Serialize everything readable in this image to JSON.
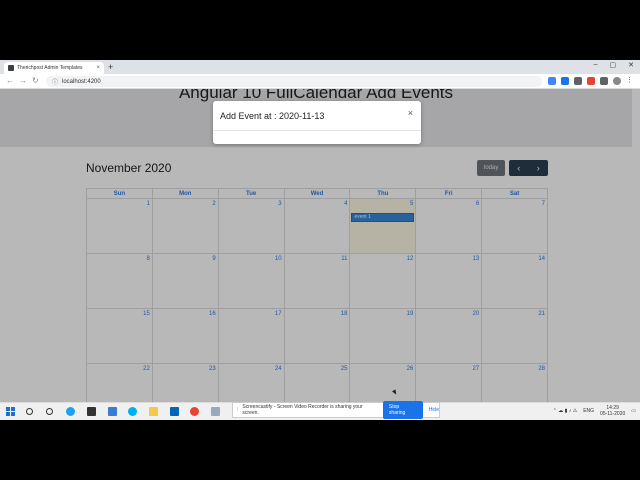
{
  "browser": {
    "tab_title": "Therichpost Admin Templates",
    "tab_close": "×",
    "new_tab": "+",
    "window_controls": [
      "–",
      "▢",
      "✕"
    ],
    "back": "←",
    "forward": "→",
    "reload": "↻",
    "url": "localhost:4200"
  },
  "page": {
    "heading": "Angular 10 FullCalendar Add Events"
  },
  "calendar": {
    "title": "November 2020",
    "today_label": "today",
    "prev_label": "‹",
    "next_label": "›",
    "weekdays": [
      "Sun",
      "Mon",
      "Tue",
      "Wed",
      "Thu",
      "Fri",
      "Sat"
    ],
    "weeks": [
      [
        "1",
        "2",
        "3",
        "4",
        "5",
        "6",
        "7"
      ],
      [
        "8",
        "9",
        "10",
        "11",
        "12",
        "13",
        "14"
      ],
      [
        "15",
        "16",
        "17",
        "18",
        "19",
        "20",
        "21"
      ],
      [
        "22",
        "23",
        "24",
        "25",
        "26",
        "27",
        "28"
      ]
    ],
    "event_label": "event 1"
  },
  "modal": {
    "title": "Add Event at : 2020-11-13",
    "close": "×"
  },
  "sharebar": {
    "message": "Screencastify - Screen Video Recorder is sharing your screen.",
    "stop_label": "Stop sharing",
    "hide_label": "Hide"
  },
  "taskbar": {
    "language": "ENG",
    "time": "14:29",
    "date": "05-11-2020"
  }
}
